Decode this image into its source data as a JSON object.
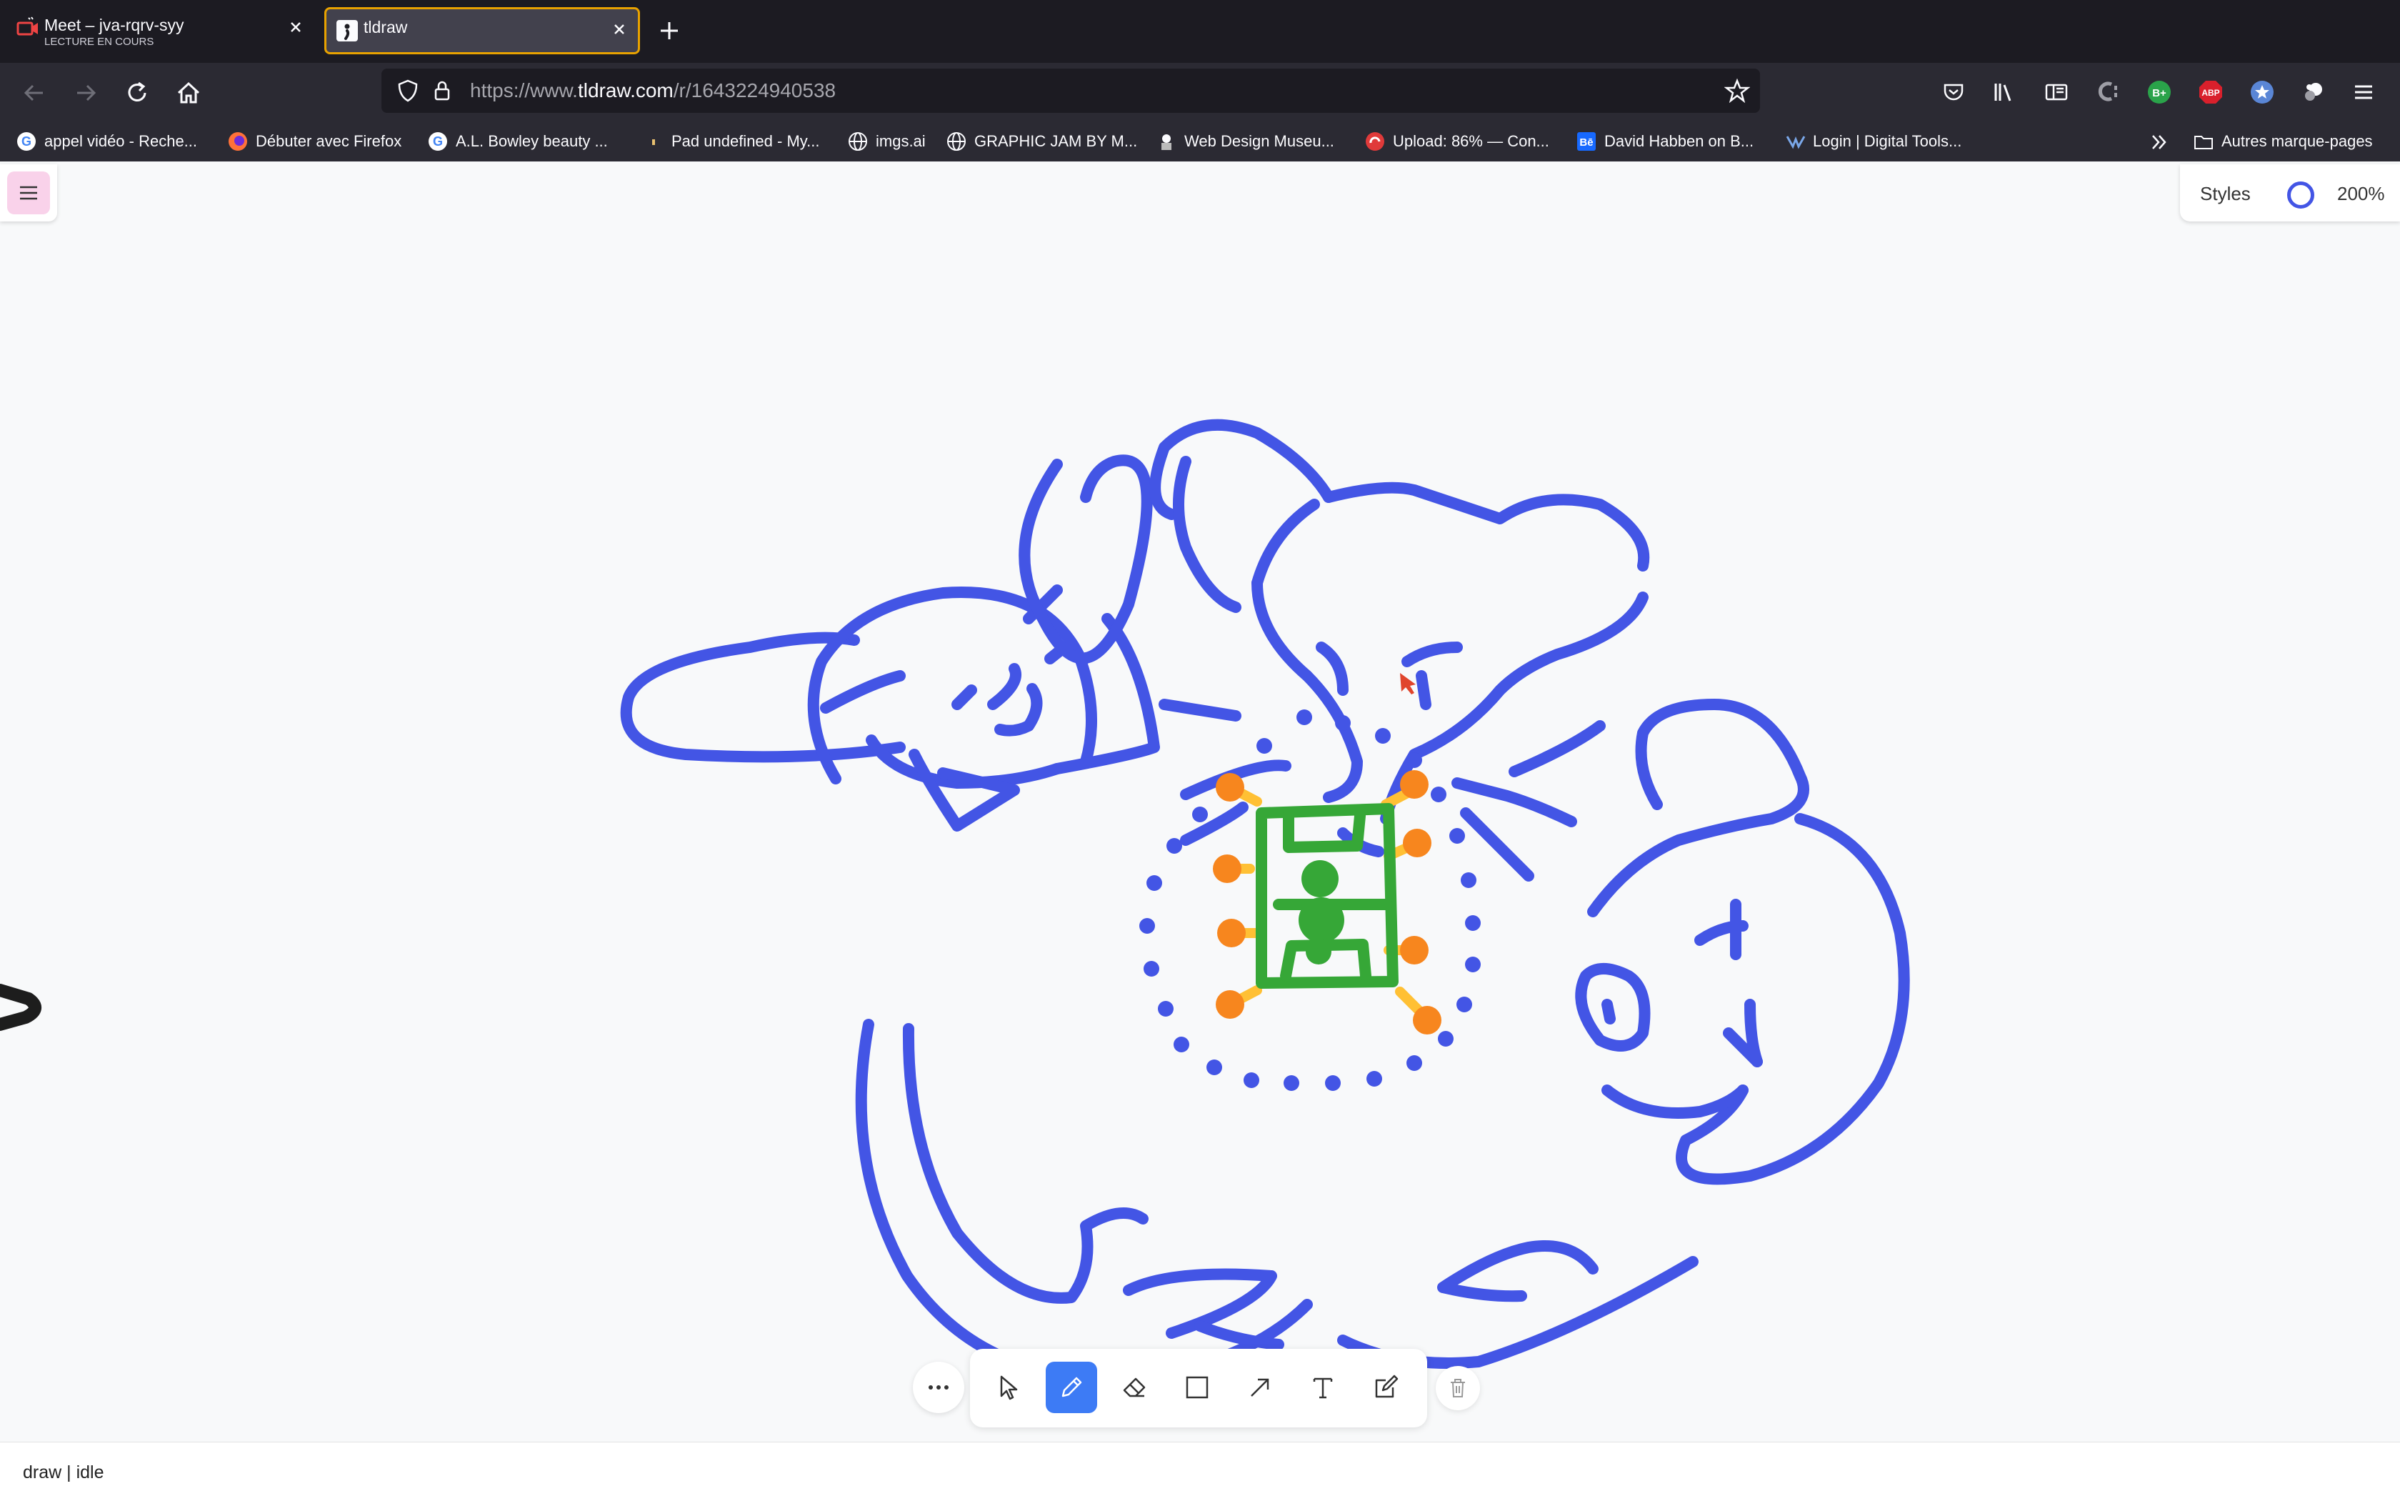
{
  "browser": {
    "tabs": [
      {
        "title": "Meet – jva-rqrv-syy",
        "subtitle": "LECTURE EN COURS",
        "icon": "meet-icon",
        "active": false
      },
      {
        "title": "tldraw",
        "subtitle": "",
        "icon": "tldraw-icon",
        "active": true
      }
    ],
    "url_prefix": "https://www.",
    "url_domain": "tldraw.com",
    "url_path": "/r/1643224940538",
    "bookmarks": [
      {
        "label": "appel vidéo - Reche...",
        "icon": "google-icon"
      },
      {
        "label": "Débuter avec Firefox",
        "icon": "firefox-icon"
      },
      {
        "label": "A.L. Bowley beauty ...",
        "icon": "google-icon"
      },
      {
        "label": "Pad undefined - My...",
        "icon": "pad-icon"
      },
      {
        "label": "imgs.ai",
        "icon": "globe-icon"
      },
      {
        "label": "GRAPHIC JAM BY M...",
        "icon": "globe-icon"
      },
      {
        "label": "Web Design Museu...",
        "icon": "museum-icon"
      },
      {
        "label": "Upload: 86% — Con...",
        "icon": "upload-icon"
      },
      {
        "label": "David Habben on B...",
        "icon": "behance-icon"
      },
      {
        "label": "Login | Digital Tools...",
        "icon": "tools-icon"
      }
    ],
    "other_bookmarks": "Autres marque-pages",
    "extensions": [
      "pocket-icon",
      "library-icon",
      "reader-icon",
      "c-icon",
      "b-plus-icon",
      "abp-icon",
      "star-ext-icon",
      "puzzle-icon",
      "hamburger-icon"
    ]
  },
  "app": {
    "styles_label": "Styles",
    "current_color": "#4355e5",
    "zoom_label": "200%",
    "status_text": "draw | idle",
    "active_tool": "draw",
    "tools": [
      "select",
      "draw",
      "eraser",
      "rectangle",
      "arrow",
      "text",
      "sticky"
    ],
    "stroke_colors": {
      "blue": "#4355e5",
      "green": "#36a737",
      "orange": "#f7861e",
      "yellow": "#ffc034",
      "black": "#1d1d1d"
    }
  }
}
